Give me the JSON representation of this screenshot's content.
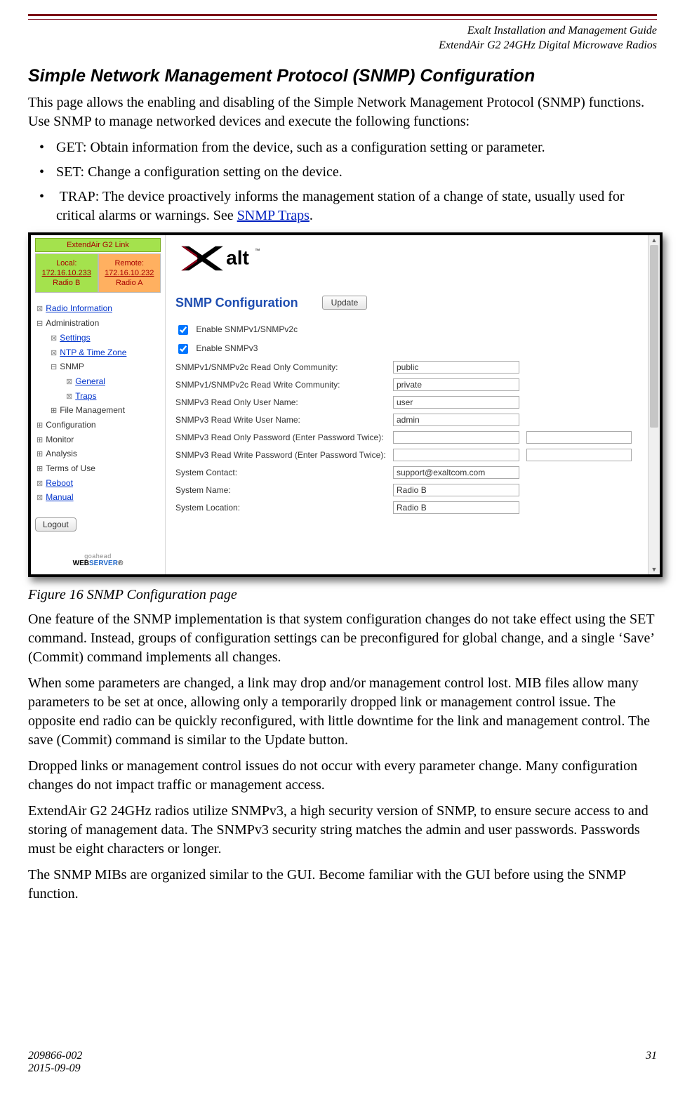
{
  "header": {
    "l1": "Exalt Installation and Management Guide",
    "l2": "ExtendAir G2 24GHz Digital Microwave Radios"
  },
  "title": "Simple Network Management Protocol (SNMP) Configuration",
  "intro": "This page allows the enabling and disabling of the Simple Network Management Protocol (SNMP) functions. Use SNMP to manage networked devices and execute the following functions:",
  "bullets": {
    "b1": "GET: Obtain information from the device, such as a configuration setting or parameter.",
    "b2": "SET: Change a configuration setting on the device.",
    "b3a": "TRAP: The device proactively informs the management station of a change of state, usually used for critical alarms or warnings. See ",
    "b3link": "SNMP Traps",
    "b3b": "."
  },
  "caption": "Figure 16   SNMP Configuration page",
  "para1": "One feature of the SNMP implementation is that system configuration changes do not take effect using the SET command. Instead, groups of configuration settings can be preconfigured for global change, and a single ‘Save’ (Commit) command implements all changes.",
  "para2": "When some parameters are changed, a link may drop and/or management control lost. MIB files allow many parameters to be set at once, allowing only a temporarily dropped link or management control issue. The opposite end radio can be quickly reconfigured, with little downtime for the link and management control. The save (Commit) command is similar to the Update button.",
  "para3": "Dropped links or management control issues do not occur with every parameter change. Many configuration changes do not impact traffic or management access.",
  "para4": "ExtendAir G2 24GHz radios utilize SNMPv3, a high security version of SNMP, to ensure secure access to and storing of management data. The SNMPv3 security string matches the admin and user passwords. Passwords must be eight characters or longer.",
  "para5": "The SNMP MIBs are organized similar to the GUI. Become familiar with the GUI before using the SNMP function.",
  "footer": {
    "doc": "209866-002",
    "date": "2015-09-09",
    "page": "31"
  },
  "shot": {
    "link_title": "ExtendAir G2 Link",
    "local": {
      "label": "Local:",
      "ip": "172.16.10.233",
      "name": "Radio B"
    },
    "remote": {
      "label": "Remote:",
      "ip": "172.16.10.232",
      "name": "Radio A"
    },
    "nav": {
      "radio_info": "Radio Information",
      "admin": "Administration",
      "settings": "Settings",
      "ntp": "NTP & Time Zone",
      "snmp": "SNMP",
      "general": "General",
      "traps": "Traps",
      "filemgmt": "File Management",
      "config": "Configuration",
      "monitor": "Monitor",
      "analysis": "Analysis",
      "terms": "Terms of Use",
      "reboot": "Reboot",
      "manual": "Manual"
    },
    "logout": "Logout",
    "webserver": {
      "goahead": "goahead",
      "web": "WEB",
      "server": "SERVER"
    },
    "brand": "alt",
    "panel_title": "SNMP Configuration",
    "update": "Update",
    "labels": {
      "en_v1v2c": "Enable SNMPv1/SNMPv2c",
      "en_v3": "Enable SNMPv3",
      "ro_comm": "SNMPv1/SNMPv2c Read Only Community:",
      "rw_comm": "SNMPv1/SNMPv2c Read Write Community:",
      "v3_ro_user": "SNMPv3 Read Only User Name:",
      "v3_rw_user": "SNMPv3 Read Write User Name:",
      "v3_ro_pw": "SNMPv3 Read Only Password (Enter Password Twice):",
      "v3_rw_pw": "SNMPv3 Read Write Password (Enter Password Twice):",
      "sys_contact": "System Contact:",
      "sys_name": "System Name:",
      "sys_loc": "System Location:"
    },
    "values": {
      "ro_comm": "public",
      "rw_comm": "private",
      "v3_ro_user": "user",
      "v3_rw_user": "admin",
      "v3_ro_pw1": "",
      "v3_ro_pw2": "",
      "v3_rw_pw1": "",
      "v3_rw_pw2": "",
      "sys_contact": "support@exaltcom.com",
      "sys_name": "Radio B",
      "sys_loc": "Radio B"
    }
  }
}
